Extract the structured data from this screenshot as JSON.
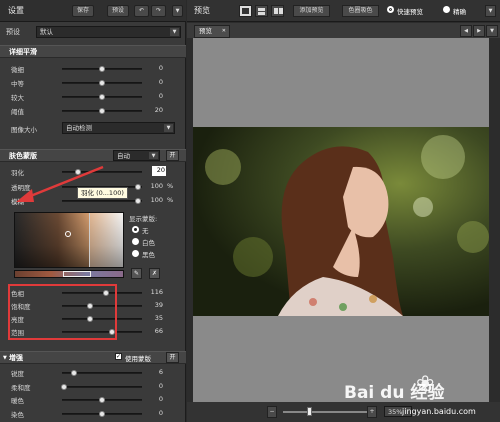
{
  "left_panel": {
    "title": "设置",
    "save_label": "保存",
    "preset_btn_label": "预设",
    "undo_icon": "undo-icon",
    "redo_icon": "redo-icon",
    "preset_label": "预设",
    "preset_value": "默认",
    "detail": {
      "title": "详细平滑",
      "sliders": [
        {
          "label": "微细",
          "value": "0",
          "pos": 0.5
        },
        {
          "label": "中等",
          "value": "0",
          "pos": 0.5
        },
        {
          "label": "较大",
          "value": "0",
          "pos": 0.5
        },
        {
          "label": "阈值",
          "value": "20",
          "pos": 0.5
        }
      ],
      "image_size_label": "图像大小",
      "image_size_value": "自动检测"
    },
    "mask": {
      "title": "肤色蒙版",
      "mode_value": "自动",
      "toggle_label": "开",
      "feather_label": "羽化",
      "feather_value": "20",
      "opacity_label": "透明度",
      "opacity_value": "100",
      "opacity_unit": "%",
      "blur_label": "模糊",
      "blur_value": "100",
      "blur_unit": "%",
      "tooltip": "羽化 (0...100)",
      "show_mask_label": "显示蒙版:",
      "radio_options": [
        "无",
        "白色",
        "黑色"
      ],
      "sliders": [
        {
          "label": "色相",
          "value": "116",
          "pos": 0.55
        },
        {
          "label": "饱和度",
          "value": "39",
          "pos": 0.35
        },
        {
          "label": "亮度",
          "value": "35",
          "pos": 0.35
        },
        {
          "label": "范围",
          "value": "66",
          "pos": 0.62
        }
      ]
    },
    "enhance": {
      "title": "增强",
      "use_mask_label": "使用蒙版",
      "toggle_label": "开",
      "sliders": [
        {
          "label": "锐度",
          "value": "6",
          "pos": 0.15
        },
        {
          "label": "柔和度",
          "value": "0",
          "pos": 0.02
        },
        {
          "label": "暖色",
          "value": "0",
          "pos": 0.5
        },
        {
          "label": "染色",
          "value": "0",
          "pos": 0.5
        }
      ]
    }
  },
  "right_panel": {
    "title": "预览",
    "add_preview_label": "添加预览",
    "compare_label": "色圈吸色",
    "quick_preview_label": "快速预览",
    "precise_label": "精确",
    "tab_label": "预览",
    "zoom_label": "35%"
  },
  "watermark": {
    "brand": "Bai du 经验",
    "url": "jingyan.baidu.com"
  },
  "colors": {
    "accent": "#e03a3a",
    "panel": "#3a3a3a",
    "header": "#454545"
  }
}
